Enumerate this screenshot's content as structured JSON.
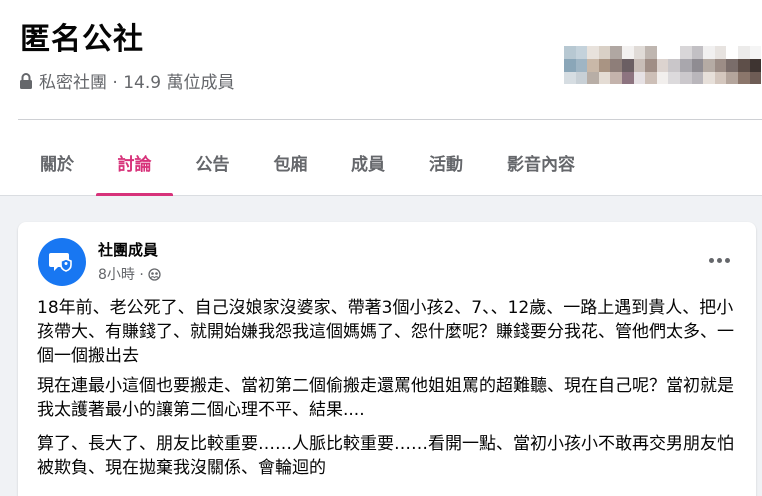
{
  "group": {
    "name": "匿名公社",
    "privacy_label": "私密社團 · 14.9 萬位成員"
  },
  "colors": {
    "accent": "#d7327a",
    "muted": "#65676b",
    "avatar_blue": "#1877f2"
  },
  "tabs": [
    {
      "label": "關於"
    },
    {
      "label": "討論"
    },
    {
      "label": "公告"
    },
    {
      "label": "包廂"
    },
    {
      "label": "成員"
    },
    {
      "label": "活動"
    },
    {
      "label": "影音內容"
    }
  ],
  "active_tab": "討論",
  "post": {
    "author": "社團成員",
    "time": "8小時 ·",
    "audience_icon": "group-audience-icon",
    "paragraphs": [
      "18年前、老公死了、自己沒娘家沒婆家、帶著3個小孩2、7、、12歲、一路上遇到貴人、把小孩帶大、有賺錢了、就開始嫌我怨我這個媽媽了、怨什麼呢？賺錢要分我花、管他們太多、一個一個搬出去",
      "現在連最小這個也要搬走、當初第二個偷搬走還罵他姐姐罵的超難聽、現在自己呢？當初就是我太護著最小的讓第二個心理不平、結果....",
      "算了、長大了、朋友比較重要……人脈比較重要……看開一點、當初小孩小不敢再交男朋友怕被欺負、現在拋棄我沒關係、會輪迴的"
    ]
  }
}
